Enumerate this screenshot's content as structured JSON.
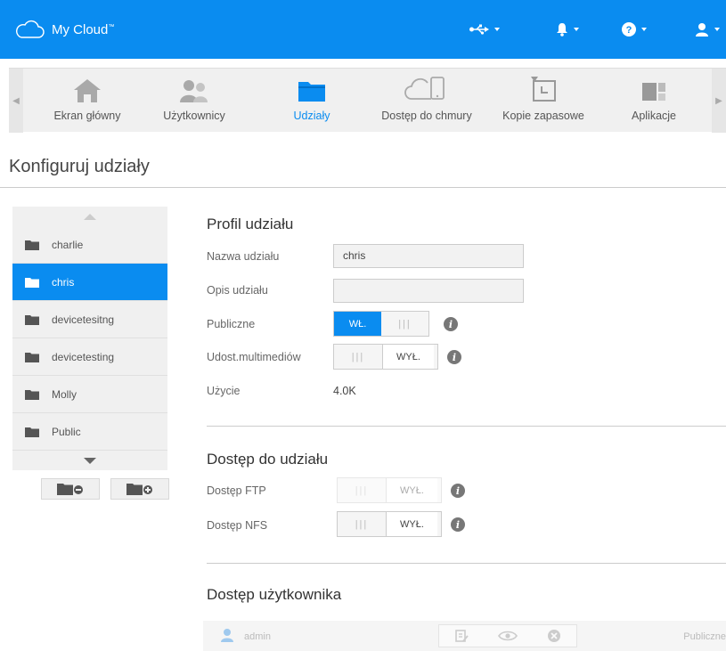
{
  "app": {
    "title": "My Cloud",
    "trademark": "™"
  },
  "topbar_icons": [
    "usb-icon",
    "bell-icon",
    "help-icon",
    "user-icon"
  ],
  "nav": {
    "items": [
      {
        "label": "Ekran główny",
        "icon": "home-icon"
      },
      {
        "label": "Użytkownicy",
        "icon": "users-icon"
      },
      {
        "label": "Udziały",
        "icon": "folder-icon",
        "active": true
      },
      {
        "label": "Dostęp do chmury",
        "icon": "cloud-device-icon"
      },
      {
        "label": "Kopie zapasowe",
        "icon": "backup-icon"
      },
      {
        "label": "Aplikacje",
        "icon": "apps-icon"
      }
    ]
  },
  "page": {
    "title": "Konfiguruj udziały"
  },
  "shares": [
    {
      "name": "charlie"
    },
    {
      "name": "chris",
      "selected": true
    },
    {
      "name": "devicetesitng"
    },
    {
      "name": "devicetesting"
    },
    {
      "name": "Molly"
    },
    {
      "name": "Public"
    }
  ],
  "profile": {
    "title": "Profil udziału",
    "name_label": "Nazwa udziału",
    "name_value": "chris",
    "desc_label": "Opis udziału",
    "desc_value": "",
    "public_label": "Publiczne",
    "public_state": "WŁ.",
    "media_label": "Udost.multimediów",
    "media_state": "WYŁ.",
    "usage_label": "Użycie",
    "usage_value": "4.0K"
  },
  "access": {
    "title": "Dostęp do udziału",
    "ftp_label": "Dostęp FTP",
    "ftp_state": "WYŁ.",
    "nfs_label": "Dostęp NFS",
    "nfs_state": "WYŁ."
  },
  "user_access": {
    "title": "Dostęp użytkownika",
    "user": "admin",
    "permission": "Publiczne"
  },
  "colors": {
    "accent": "#0a8cf0"
  }
}
